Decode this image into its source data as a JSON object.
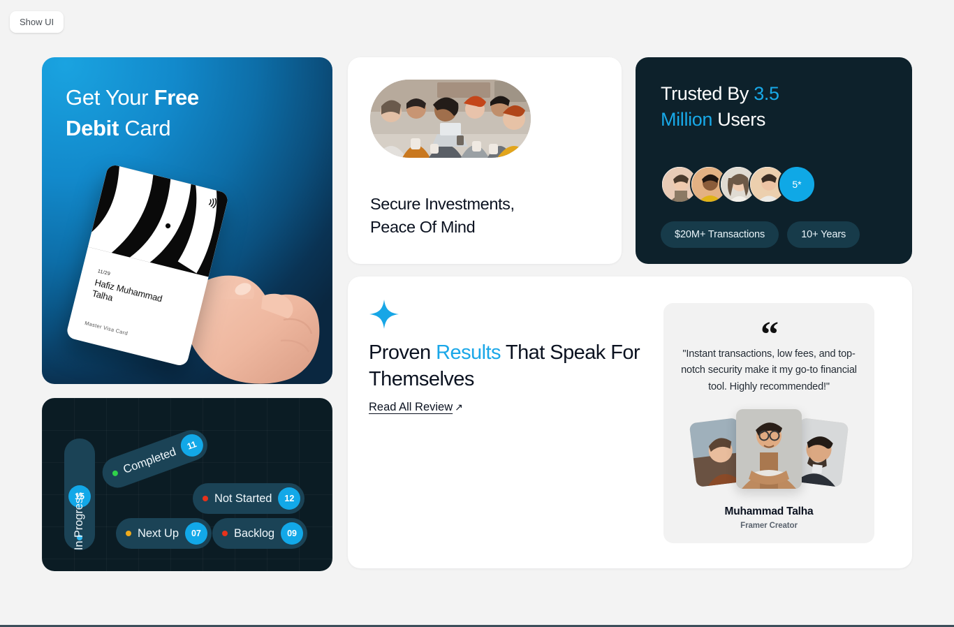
{
  "toolbar": {
    "show_ui_label": "Show UI"
  },
  "debit": {
    "headline_pre": "Get Your ",
    "headline_bold1": "Free",
    "headline_bold2": "Debit",
    "headline_post": " Card",
    "card": {
      "expiry": "11/29",
      "holder": "Hafiz Muhammad Talha",
      "type": "Master Visa Card",
      "nfc_icon": "contactless-icon"
    }
  },
  "status_board": {
    "chips": [
      {
        "label": "In Progress",
        "count": "15",
        "dot": "#2fb7f0"
      },
      {
        "label": "Completed",
        "count": "11",
        "dot": "#2fd24a"
      },
      {
        "label": "Not Started",
        "count": "12",
        "dot": "#e8321b"
      },
      {
        "label": "Next Up",
        "count": "07",
        "dot": "#efab1c"
      },
      {
        "label": "Backlog",
        "count": "09",
        "dot": "#e8321b"
      }
    ]
  },
  "secure": {
    "title_line1": "Secure Investments,",
    "title_line2": "Peace Of Mind",
    "image_alt": "team-meeting-photo"
  },
  "trusted": {
    "headline_pre": "Trusted By ",
    "headline_hi1": "3.5",
    "headline_mid": " ",
    "headline_hi2": "Million",
    "headline_post": " Users",
    "rating_badge": "5*",
    "avatar_count": 4,
    "pills": [
      {
        "label": "$20M+ Transactions"
      },
      {
        "label": "10+ Years"
      }
    ]
  },
  "results": {
    "sparkle_icon": "sparkle-icon",
    "title_pre": "Proven ",
    "title_hi": "Results",
    "title_post": " That Speak For Themselves",
    "read_link_label": "Read All Review",
    "read_link_arrow": "↗",
    "testimonial": {
      "quote_mark": "“",
      "quote": "\"Instant transactions, low fees, and top-notch security make it my go-to financial tool. Highly recommended!\"",
      "name": "Muhammad Talha",
      "role": "Framer Creator"
    }
  },
  "colors": {
    "accent_blue": "#12a8e8",
    "dark_navy": "#0d212b",
    "board_bg": "#0b1c24",
    "chip_bg": "#1b4356",
    "page_bg": "#f3f3f3"
  }
}
